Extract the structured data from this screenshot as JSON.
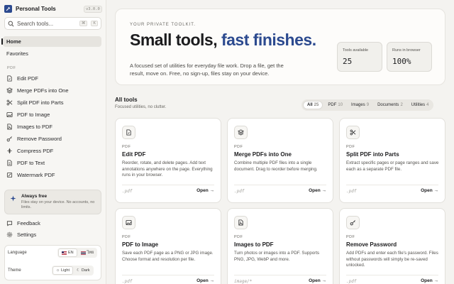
{
  "app": {
    "name": "Personal Tools",
    "version": "v3.0.0"
  },
  "search": {
    "placeholder": "Search tools...",
    "kbd1": "⌘",
    "kbd2": "K"
  },
  "nav": {
    "home": "Home",
    "favorites": "Favorites",
    "section": "PDF",
    "items": [
      "Edit PDF",
      "Merge PDFs into One",
      "Split PDF into Parts",
      "PDF to Image",
      "Images to PDF",
      "Remove Password",
      "Compress PDF",
      "PDF to Text",
      "Watermark PDF"
    ]
  },
  "always_free": {
    "title": "Always free",
    "text": "Files stay on your device. No accounts, no limits."
  },
  "footer_nav": {
    "feedback": "Feedback",
    "settings": "Settings"
  },
  "prefs": {
    "language_label": "Language",
    "lang_en": "EN",
    "lang_th": "ไทย",
    "theme_label": "Theme",
    "light": "Light",
    "dark": "Dark"
  },
  "hero": {
    "eyebrow": "YOUR PRIVATE TOOLKIT.",
    "title_a": "Small tools, ",
    "title_b": "fast finishes.",
    "desc": "A focused set of utilities for everyday file work. Drop a file, get the result, move on. Free, no sign-up, files stay on your device.",
    "stat1_label": "Tools available",
    "stat1_value": "25",
    "stat2_label": "Runs in browser",
    "stat2_value": "100%"
  },
  "section": {
    "title": "All tools",
    "subtitle": "Focused utilities, no clutter."
  },
  "filters": [
    {
      "label": "All",
      "count": "25"
    },
    {
      "label": "PDF",
      "count": "10"
    },
    {
      "label": "Images",
      "count": "9"
    },
    {
      "label": "Documents",
      "count": "2"
    },
    {
      "label": "Utilities",
      "count": "4"
    }
  ],
  "cards": [
    {
      "cat": "PDF",
      "title": "Edit PDF",
      "desc": "Reorder, rotate, and delete pages. Add text annotations anywhere on the page. Everything runs in your browser.",
      "ext": ".pdf",
      "open": "Open →",
      "icon": "file-edit-icon"
    },
    {
      "cat": "PDF",
      "title": "Merge PDFs into One",
      "desc": "Combine multiple PDF files into a single document. Drag to reorder before merging.",
      "ext": ".pdf",
      "open": "Open →",
      "icon": "layers-icon"
    },
    {
      "cat": "PDF",
      "title": "Split PDF into Parts",
      "desc": "Extract specific pages or page ranges and save each as a separate PDF file.",
      "ext": ".pdf",
      "open": "Open →",
      "icon": "scissors-icon"
    },
    {
      "cat": "PDF",
      "title": "PDF to Image",
      "desc": "Save each PDF page as a PNG or JPG image. Choose format and resolution per file.",
      "ext": ".pdf",
      "open": "Open →",
      "icon": "image-icon"
    },
    {
      "cat": "PDF",
      "title": "Images to PDF",
      "desc": "Turn photos or images into a PDF. Supports PNG, JPG, WebP and more.",
      "ext": "image/*",
      "open": "Open →",
      "icon": "file-image-icon"
    },
    {
      "cat": "PDF",
      "title": "Remove Password",
      "desc": "Add PDFs and enter each file's password. Files without passwords will simply be re-saved unlocked.",
      "ext": ".pdf",
      "open": "Open →",
      "icon": "key-icon"
    }
  ],
  "colors": {
    "accent": "#2c4a8f",
    "background": "#f4f3f0"
  }
}
